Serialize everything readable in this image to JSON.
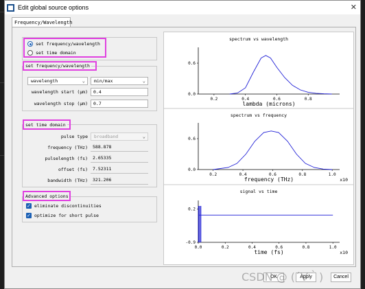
{
  "window": {
    "title": "Edit global source options"
  },
  "tab": {
    "label": "Frequency/Wavelength"
  },
  "mode": {
    "option1": "set frequency/wavelength",
    "option2": "set time domain"
  },
  "freqwl": {
    "legend": "set frequency/wavelength",
    "param_combo": "wavelength",
    "range_combo": "min/max",
    "start_label": "wavelength start (μm)",
    "start_value": "0.4",
    "stop_label": "wavelength stop (μm)",
    "stop_value": "0.7"
  },
  "timedomain": {
    "legend": "set time domain",
    "pulse_type_label": "pulse type",
    "pulse_type_value": "broadband",
    "frequency_label": "frequency (THz)",
    "frequency_value": "588.878",
    "pulselength_label": "pulselength (fs)",
    "pulselength_value": "2.65335",
    "offset_label": "offset (fs)",
    "offset_value": "7.52311",
    "bandwidth_label": "bandwidth (THz)",
    "bandwidth_value": "321.206"
  },
  "advanced": {
    "legend": "Advanced options",
    "opt1": "eliminate discontinuities",
    "opt2": "optimize for short pulse"
  },
  "chart_data": [
    {
      "type": "line",
      "title": "spectrum vs wavelength",
      "xlabel": "lambda (microns)",
      "xlim": [
        0.1,
        1.0
      ],
      "ylim": [
        0,
        0.8
      ],
      "xticks": [
        "0.2",
        "0.4",
        "0.6",
        "0.8"
      ],
      "yticks": [
        "0.0",
        "0.6"
      ],
      "x": [
        0.3,
        0.35,
        0.4,
        0.45,
        0.5,
        0.53,
        0.56,
        0.6,
        0.65,
        0.7,
        0.75,
        0.8,
        0.85,
        0.9,
        0.95
      ],
      "y": [
        0.0,
        0.02,
        0.12,
        0.42,
        0.7,
        0.75,
        0.7,
        0.52,
        0.32,
        0.17,
        0.08,
        0.035,
        0.015,
        0.005,
        0.0
      ]
    },
    {
      "type": "line",
      "title": "spectrum vs frequency",
      "xlabel": "frequency (THz)",
      "xlim": [
        0.1,
        1.05
      ],
      "ylim": [
        0,
        0.8
      ],
      "xticks": [
        "0.2",
        "0.4",
        "0.6",
        "0.8",
        "1.0"
      ],
      "yticks": [
        "0.0",
        "0.6"
      ],
      "x_scale_label": "x10",
      "x": [
        0.2,
        0.3,
        0.36,
        0.42,
        0.48,
        0.54,
        0.59,
        0.64,
        0.7,
        0.76,
        0.82,
        0.88,
        0.94,
        1.0
      ],
      "y": [
        0.0,
        0.04,
        0.12,
        0.3,
        0.55,
        0.72,
        0.75,
        0.72,
        0.55,
        0.3,
        0.12,
        0.04,
        0.01,
        0.0
      ]
    },
    {
      "type": "line",
      "title": "signal vs time",
      "xlabel": "time (fs)",
      "xlim": [
        0.0,
        1.05
      ],
      "ylim": [
        -0.9,
        0.3
      ],
      "xticks": [
        "0.0",
        "0.2",
        "0.4",
        "0.6",
        "0.8",
        "1.0"
      ],
      "yticks": [
        "0.2",
        "-0.9"
      ],
      "x_scale_label": "x10",
      "x": [
        0.0,
        0.01,
        0.02,
        1.0
      ],
      "y": [
        0.0,
        0.0,
        0.0,
        0.0
      ]
    }
  ],
  "buttons": {
    "ok": "OK",
    "apply": "Apply",
    "cancel": "Cancel"
  },
  "watermark": "CSDN @ (´∀｀)"
}
